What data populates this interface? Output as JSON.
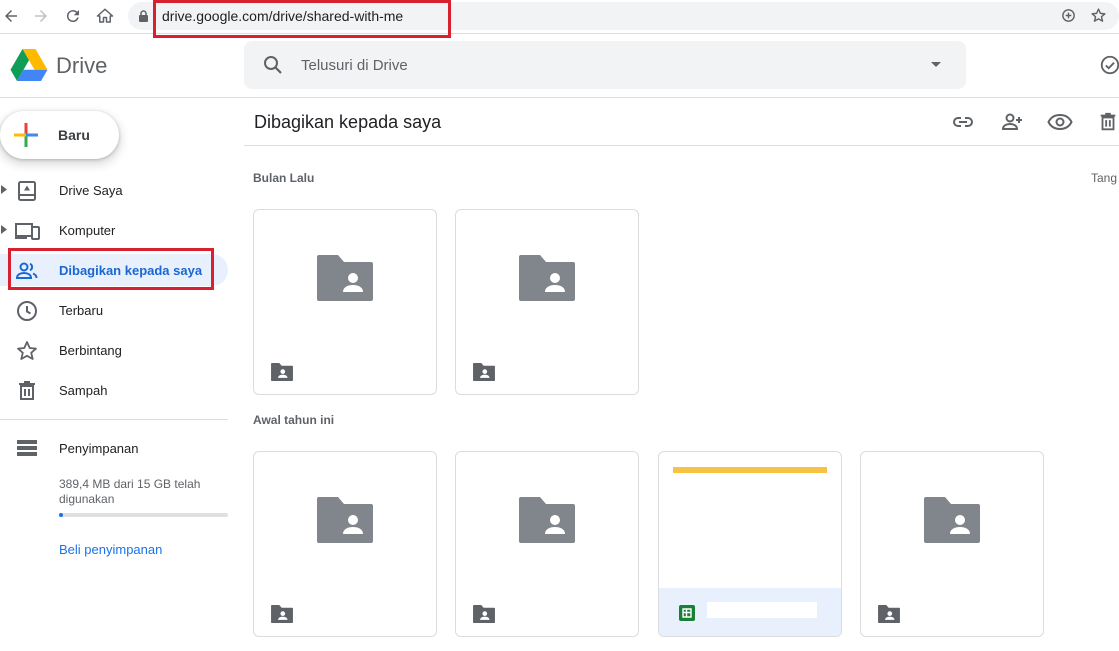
{
  "browser": {
    "url": "drive.google.com/drive/shared-with-me"
  },
  "header": {
    "logo_text": "Drive",
    "search_placeholder": "Telusuri di Drive"
  },
  "sidebar": {
    "new_label": "Baru",
    "items": [
      {
        "label": "Drive Saya",
        "icon": "my-drive-icon",
        "expandable": true
      },
      {
        "label": "Komputer",
        "icon": "computer-icon",
        "expandable": true
      },
      {
        "label": "Dibagikan kepada saya",
        "icon": "people-icon",
        "active": true
      },
      {
        "label": "Terbaru",
        "icon": "clock-icon"
      },
      {
        "label": "Berbintang",
        "icon": "star-icon"
      },
      {
        "label": "Sampah",
        "icon": "trash-icon"
      }
    ],
    "storage": {
      "label": "Penyimpanan",
      "usage_text": "389,4 MB dari 15 GB telah digunakan",
      "used_fraction": 0.026,
      "buy_label": "Beli penyimpanan"
    }
  },
  "main": {
    "title": "Dibagikan kepada saya",
    "sort_label": "Tang",
    "toolbar": [
      "link-icon",
      "add-person-icon",
      "eye-icon",
      "trash-icon"
    ],
    "sections": [
      {
        "label": "Bulan Lalu",
        "items": [
          {
            "type": "shared-folder"
          },
          {
            "type": "shared-folder"
          }
        ]
      },
      {
        "label": "Awal tahun ini",
        "items": [
          {
            "type": "shared-folder"
          },
          {
            "type": "shared-folder"
          },
          {
            "type": "spreadsheet"
          },
          {
            "type": "shared-folder"
          }
        ]
      }
    ]
  },
  "colors": {
    "accent": "#1a73e8",
    "active_bg": "#e8f0fe",
    "highlight_box": "#d9202f",
    "folder_gray": "#80868b"
  }
}
